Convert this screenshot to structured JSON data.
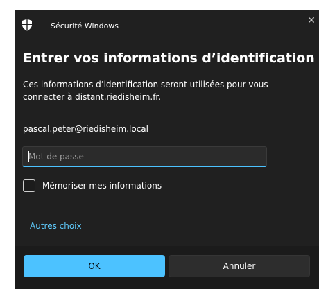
{
  "window": {
    "title": "Sécurité Windows",
    "close_glyph": "✕"
  },
  "dialog": {
    "heading": "Entrer vos informations d’identification",
    "description": "Ces informations d’identification seront utilisées pour vous connecter à distant.riedisheim.fr.",
    "username": "pascal.peter@riedisheim.local",
    "password_placeholder": "Mot de passe",
    "password_value": "",
    "remember_label": "Mémoriser mes informations",
    "remember_checked": false,
    "other_choices": "Autres choix"
  },
  "buttons": {
    "ok": "OK",
    "cancel": "Annuler"
  },
  "icons": {
    "app": "shield-icon",
    "close": "close-icon",
    "checkbox": "checkbox-icon"
  },
  "colors": {
    "accent": "#4cc2ff",
    "link": "#60cdff",
    "background": "#202020",
    "footer": "#1b1b1b"
  }
}
